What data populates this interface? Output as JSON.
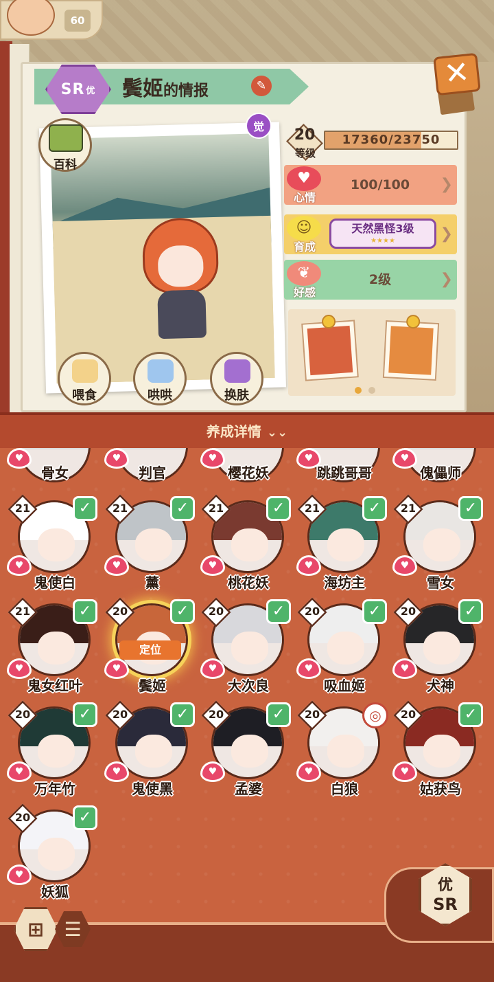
{
  "header": {
    "player_level": "60",
    "rarity": "SR",
    "rarity_suffix": "优",
    "char_name": "鬓姬",
    "title_suffix": "的情报",
    "awaken_label": "觉",
    "close_label": "✕"
  },
  "info": {
    "baike_label": "百科",
    "actions": [
      {
        "label": "喂食",
        "icon": "noodle-bowl-icon",
        "color": "#f3d28a"
      },
      {
        "label": "哄哄",
        "icon": "milk-carton-icon",
        "color": "#9fc6ee"
      },
      {
        "label": "换肤",
        "icon": "kimono-icon",
        "color": "#a36fd0"
      }
    ]
  },
  "stats": {
    "level": "20",
    "level_label": "等级",
    "exp_text": "17360/23750",
    "exp_fraction": 0.731,
    "mood_label": "心情",
    "mood_value": "100/100",
    "grow_label": "育成",
    "trait": "天然黑怪3级",
    "trait_stars": "★★★★",
    "favor_label": "好感",
    "favor_value": "2级"
  },
  "gifts": {
    "items": [
      "ramen-gift-icon",
      "daruma-gift-icon"
    ],
    "active_dot": 0
  },
  "panel": {
    "title": "养成详情",
    "chevron": "⌄⌄",
    "locate_label": "定位"
  },
  "partial_row": [
    {
      "name": "骨女"
    },
    {
      "name": "判官"
    },
    {
      "name": "樱花妖"
    },
    {
      "name": "跳跳哥哥"
    },
    {
      "name": "傀儡师"
    }
  ],
  "characters": [
    {
      "name": "鬼使白",
      "level": "21",
      "checked": true,
      "hair": "#ffffff"
    },
    {
      "name": "薰",
      "level": "21",
      "checked": true,
      "hair": "#bfc4c8"
    },
    {
      "name": "桃花妖",
      "level": "21",
      "checked": true,
      "hair": "#7a3a30"
    },
    {
      "name": "海坊主",
      "level": "21",
      "checked": true,
      "hair": "#3d7a6a"
    },
    {
      "name": "雪女",
      "level": "21",
      "checked": true,
      "hair": "#e9e6e3"
    },
    {
      "name": "鬼女红叶",
      "level": "21",
      "checked": true,
      "hair": "#3a1e18"
    },
    {
      "name": "鬓姬",
      "level": "20",
      "checked": true,
      "hair": "#c8663a",
      "selected": true
    },
    {
      "name": "大次良",
      "level": "20",
      "checked": true,
      "hair": "#d8d8dc"
    },
    {
      "name": "吸血姬",
      "level": "20",
      "checked": true,
      "hair": "#eeeeee"
    },
    {
      "name": "犬神",
      "level": "20",
      "checked": true,
      "hair": "#262628"
    },
    {
      "name": "万年竹",
      "level": "20",
      "checked": true,
      "hair": "#1f3a36"
    },
    {
      "name": "鬼使黑",
      "level": "20",
      "checked": true,
      "hair": "#2a2a3a"
    },
    {
      "name": "孟婆",
      "level": "20",
      "checked": true,
      "hair": "#1e1e24"
    },
    {
      "name": "白狼",
      "level": "20",
      "checked": false,
      "hair": "#f2f0ee",
      "special": "◎"
    },
    {
      "name": "姑获鸟",
      "level": "20",
      "checked": true,
      "hair": "#8a2a22"
    },
    {
      "name": "妖狐",
      "level": "20",
      "checked": true,
      "hair": "#f4f4f8"
    }
  ],
  "footer": {
    "grid_view_label": "⊞",
    "list_view_label": "☰",
    "rarity_top": "优",
    "rarity_bottom": "SR"
  }
}
